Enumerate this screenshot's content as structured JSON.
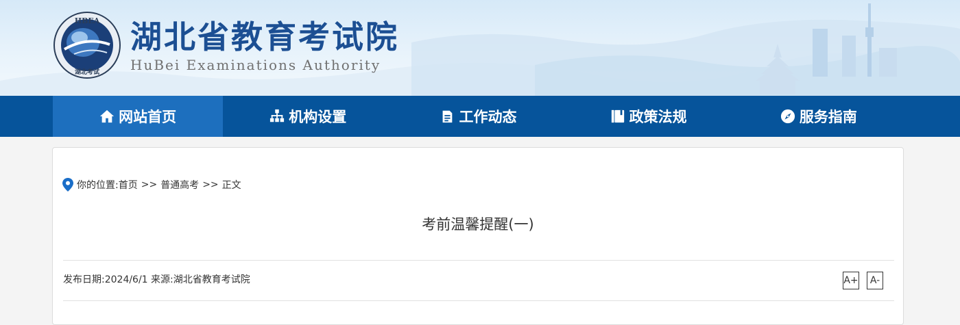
{
  "header": {
    "title": "湖北省教育考试院",
    "subtitle": "HuBei Examinations Authority",
    "emblem_top_text": "HBEA",
    "emblem_bottom_text": "湖北考试"
  },
  "nav": {
    "items": [
      {
        "label": "网站首页",
        "icon": "home-icon",
        "active": true
      },
      {
        "label": "机构设置",
        "icon": "org-chart-icon",
        "active": false
      },
      {
        "label": "工作动态",
        "icon": "document-icon",
        "active": false
      },
      {
        "label": "政策法规",
        "icon": "book-icon",
        "active": false
      },
      {
        "label": "服务指南",
        "icon": "compass-icon",
        "active": false
      }
    ]
  },
  "breadcrumb": {
    "prefix": "你的位置:",
    "home": "首页",
    "separator": ">>",
    "category": "普通高考",
    "current": "正文"
  },
  "article": {
    "title": "考前温馨提醒(一)",
    "meta": "发布日期:2024/6/1 来源:湖北省教育考试院",
    "font_increase": "A+",
    "font_decrease": "A-"
  },
  "colors": {
    "nav_bg": "#06549b",
    "nav_active": "#1d6fbe",
    "title_blue": "#1c4f93",
    "pin_blue": "#1a6ec8"
  }
}
